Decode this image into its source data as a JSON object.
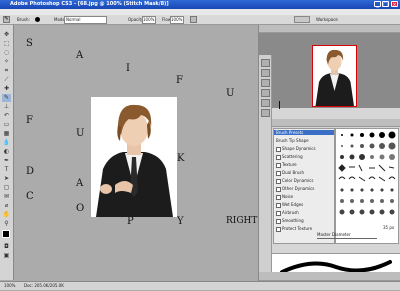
{
  "titlebar": {
    "title": "Adobe Photoshop CS3 - [68.jpg @ 100% (Stitch Mask/8)]"
  },
  "menubar": {
    "items": [
      "File",
      "Edit",
      "Image",
      "Layer",
      "Select",
      "Filter",
      "View",
      "Window",
      "Help"
    ]
  },
  "options": {
    "brush_label": "Brush:",
    "mode_label": "Mode:",
    "mode_value": "Normal",
    "opacity_label": "Opacity:",
    "opacity_value": "100%",
    "flow_label": "Flow:",
    "flow_value": "100%",
    "workspace_label": "Workspace"
  },
  "canvas": {
    "letters": [
      "S",
      "A",
      "I",
      "F",
      "U",
      "L",
      "F",
      "U",
      "K",
      "D",
      "A",
      "C",
      "O",
      "P",
      "Y",
      "RIGHT©"
    ]
  },
  "panels": {
    "top_tabs": [
      "Navigator",
      "Info"
    ],
    "mid_tabs": [
      "Color",
      "Swatches",
      "Styles",
      "Brushes",
      "Clone Source"
    ],
    "brush_presets": "Brush Presets",
    "brush_tip_shape": "Brush Tip Shape",
    "brush_options": [
      "Shape Dynamics",
      "Scattering",
      "Texture",
      "Dual Brush",
      "Color Dynamics",
      "Other Dynamics",
      "Noise",
      "Wet Edges",
      "Airbrush",
      "Smoothing",
      "Protect Texture"
    ],
    "master_diameter": "Master Diameter",
    "diameter_value": "35 px",
    "bottom_tabs": [
      "Layers",
      "Channels",
      "Paths"
    ]
  },
  "status": {
    "zoom": "100%",
    "doc": "Doc: 205.0K/205.0K"
  }
}
